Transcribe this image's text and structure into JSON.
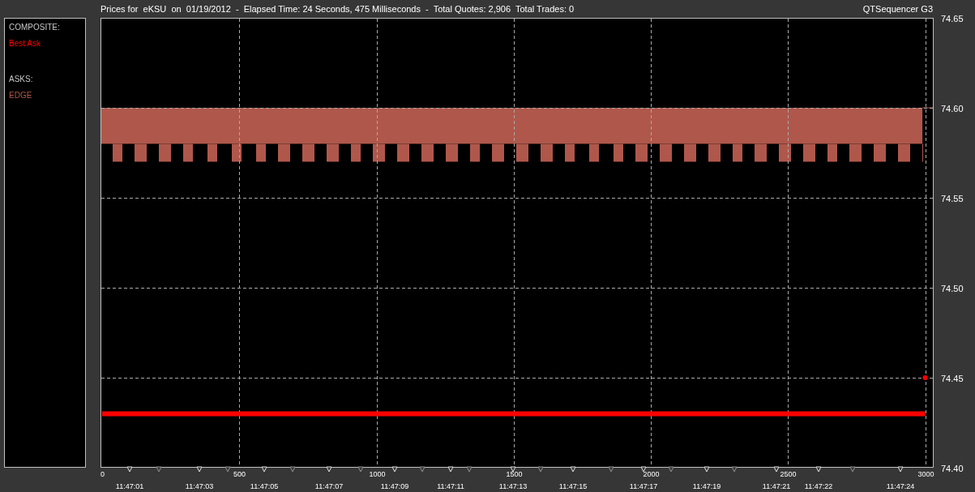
{
  "header": {
    "title": "Prices for  eKSU  on  01/19/2012  -  Elapsed Time: 24 Seconds, 475 Milliseconds  -  Total Quotes: 2,906  Total Trades: 0",
    "app_name": "QTSequencer G3"
  },
  "legend": {
    "groups": [
      {
        "heading": "COMPOSITE:"
      },
      {
        "heading": "ASKS:",
        "items": [
          {
            "label": "EDGE",
            "color": "#b0574b"
          }
        ]
      }
    ]
  },
  "chart": {
    "chart_data": {
      "type": "line",
      "x": [
        0,
        3000
      ],
      "series": [
        {
          "name": "Best Ask",
          "color": "#ff0000",
          "values": [
            74.43,
            74.43
          ]
        },
        {
          "color": "#ff0000",
          "marker": "circle",
          "values": [
            null,
            74.45
          ]
        }
      ],
      "grid": true,
      "bands": [
        {
          "axis": "y",
          "from": 74.58,
          "to": 74.6,
          "color": "#b0574b"
        }
      ],
      "xlim": [
        -6,
        3031
      ],
      "ylim": [
        74.4,
        74.65
      ],
      "xticks": [
        0,
        500,
        1000,
        1500,
        2000,
        2500,
        3000
      ],
      "yticks": [
        {
          "value": 74.4,
          "label": "74.40"
        },
        {
          "value": 74.45,
          "label": "74.45"
        },
        {
          "value": 74.5,
          "label": "74.50"
        },
        {
          "value": 74.55,
          "label": "74.55"
        },
        {
          "value": 74.6,
          "label": "74.60"
        },
        {
          "value": 74.65,
          "label": "74.65"
        }
      ]
    },
    "time_labels": [
      "11:47:01",
      "11:47:03",
      "11:47:05",
      "11:47:07",
      "11:47:09",
      "11:47:11",
      "11:47:13",
      "11:47:15",
      "11:47:17",
      "11:47:19",
      "11:47:21",
      "11:47:22",
      "11:47:24"
    ]
  }
}
